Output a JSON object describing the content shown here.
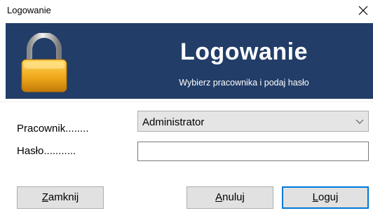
{
  "window": {
    "title": "Logowanie",
    "close_icon": "close-icon"
  },
  "banner": {
    "heading": "Logowanie",
    "subtitle": "Wybierz pracownika i podaj hasło",
    "icon": "padlock-icon",
    "background_color": "#223d68",
    "text_color": "#ffffff"
  },
  "form": {
    "employee_label": "Pracownik",
    "employee_dots": "........",
    "employee_value": "Administrator",
    "password_label": "Hasło",
    "password_dots": "...........",
    "password_value": ""
  },
  "buttons": {
    "close": {
      "access_key": "Z",
      "rest": "amknij"
    },
    "cancel": {
      "access_key": "A",
      "rest": "nuluj"
    },
    "login": {
      "access_key": "L",
      "rest": "oguj"
    }
  },
  "colors": {
    "default_button_border": "#0078d7"
  }
}
